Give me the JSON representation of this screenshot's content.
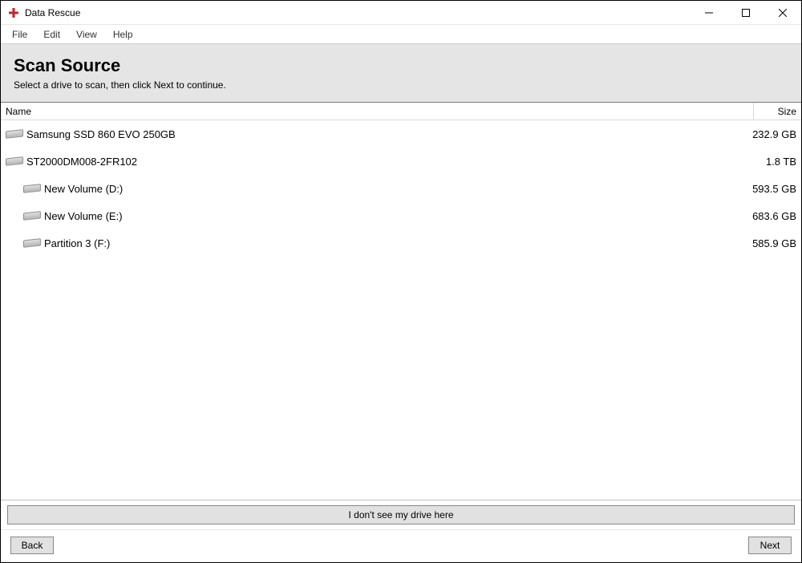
{
  "window": {
    "title": "Data Rescue"
  },
  "menu": {
    "items": [
      "File",
      "Edit",
      "View",
      "Help"
    ]
  },
  "header": {
    "title": "Scan Source",
    "subtitle": "Select a drive to scan, then click Next to continue."
  },
  "columns": {
    "name": "Name",
    "size": "Size"
  },
  "drives": [
    {
      "name": "Samsung SSD 860 EVO 250GB",
      "size": "232.9 GB",
      "child": false
    },
    {
      "name": "ST2000DM008-2FR102",
      "size": "1.8 TB",
      "child": false
    },
    {
      "name": "New Volume (D:)",
      "size": "593.5 GB",
      "child": true
    },
    {
      "name": "New Volume (E:)",
      "size": "683.6 GB",
      "child": true
    },
    {
      "name": "Partition 3 (F:)",
      "size": "585.9 GB",
      "child": true
    }
  ],
  "buttons": {
    "no_drive": "I don't see my drive here",
    "back": "Back",
    "next": "Next"
  }
}
